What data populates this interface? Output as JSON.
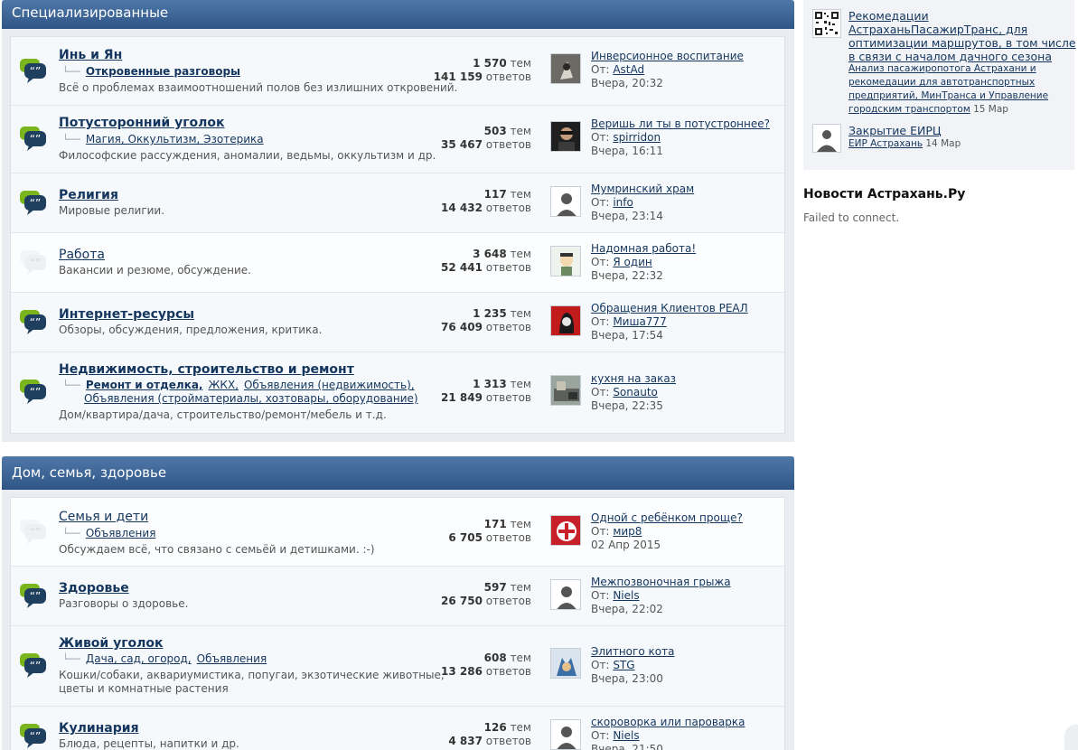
{
  "sections": [
    {
      "title": "Специализированные",
      "forums": [
        {
          "title": "Инь и Ян",
          "read": false,
          "subforums": [
            {
              "label": "Откровенные разговоры",
              "bold": true
            }
          ],
          "description": "Всё о проблемах взаимоотношений полов без излишних откровений.",
          "threads": "1 570",
          "posts": "141 159",
          "last_title": "Инверсионное воспитание",
          "last_user": "AstAd",
          "last_date": "Вчера, 20:32"
        },
        {
          "title": "Потусторонний уголок",
          "read": false,
          "subforums": [
            {
              "label": "Магия, Оккультизм, Эзотерика",
              "bold": false
            }
          ],
          "description": "Философские рассуждения, аномалии, ведьмы, оккультизм и др.",
          "threads": "503",
          "posts": "35 467",
          "last_title": "Веришь ли ты в потустроннее?",
          "last_user": "spirridon",
          "last_date": "Вчера, 16:11"
        },
        {
          "title": "Религия",
          "read": false,
          "subforums": [],
          "description": "Мировые религии.",
          "threads": "117",
          "posts": "14 432",
          "last_title": "Мумринский храм",
          "last_user": "info",
          "last_date": "Вчера, 23:14"
        },
        {
          "title": "Работа",
          "read": true,
          "subforums": [],
          "description": "Вакансии и резюме, обсуждение.",
          "threads": "3 648",
          "posts": "52 441",
          "last_title": "Надомная работа!",
          "last_user": "Я один",
          "last_date": "Вчера, 22:32"
        },
        {
          "title": "Интернет-ресурсы",
          "read": false,
          "subforums": [],
          "description": "Обзоры, обсуждения, предложения, критика.",
          "threads": "1 235",
          "posts": "76 409",
          "last_title": "Обращения Клиентов РЕАЛ",
          "last_user": "Миша777",
          "last_date": "Вчера, 17:54"
        },
        {
          "title": "Недвижимость, строительство и ремонт",
          "read": false,
          "subforums": [
            {
              "label": "Ремонт и отделка,",
              "bold": true
            },
            {
              "label": "ЖКХ,",
              "bold": false
            },
            {
              "label": "Объявления (недвижимость),",
              "bold": false
            }
          ],
          "subforums_line2": "Объявления (стройматериалы, хозтовары, оборудование)",
          "description": "Дом/квартира/дача, строительство/ремонт/мебель и т.д.",
          "threads": "1 313",
          "posts": "21 849",
          "last_title": "кухня на заказ",
          "last_user": "Sonauto",
          "last_date": "Вчера, 22:35"
        }
      ]
    },
    {
      "title": "Дом, семья, здоровье",
      "forums": [
        {
          "title": "Семья и дети",
          "read": true,
          "subforums": [
            {
              "label": "Объявления",
              "bold": false
            }
          ],
          "description": "Обсуждаем всё, что связано с семьёй и детишками. :-)",
          "threads": "171",
          "posts": "6 705",
          "last_title": "Одной с ребёнком проще?",
          "last_user": "мир8",
          "last_date": "02 Апр 2015"
        },
        {
          "title": "Здоровье",
          "read": false,
          "subforums": [],
          "description": "Разговоры о здоровье.",
          "threads": "597",
          "posts": "26 750",
          "last_title": "Межпозвоночная грыжа",
          "last_user": "Niels",
          "last_date": "Вчера, 22:02"
        },
        {
          "title": "Живой уголок",
          "read": false,
          "subforums": [
            {
              "label": "Дача, сад, огород,",
              "bold": false
            },
            {
              "label": "Объявления",
              "bold": false
            }
          ],
          "description": "Кошки/собаки, аквариумистика, попугаи, экзотические животные,",
          "description_line2": "цветы и комнатные растения",
          "threads": "608",
          "posts": "13 286",
          "last_title": "Элитного кота",
          "last_user": "STG",
          "last_date": "Вчера, 23:00"
        },
        {
          "title": "Кулинария",
          "read": false,
          "subforums": [],
          "description": "Блюда, рецепты, напитки и др.",
          "threads": "126",
          "posts": "4 837",
          "last_title": "скороворка или пароварка",
          "last_user": "Niels",
          "last_date": "Вчера, 21:50"
        }
      ]
    }
  ],
  "labels": {
    "threads_word": "тем",
    "posts_word": "ответов",
    "from_prefix": "От:"
  },
  "sidebar": {
    "items": [
      {
        "title": "Рекомедации АстраханьПасажирТранс, для оптимизации маршрутов, в том числе в связи с началом дачного сезона",
        "sub_link": "Анализ пасажиропотога Астрахани и рекомедации для автотранспортных предприятий, МинТранса и Управление городским транспортом",
        "sub_date": "15 Мар"
      },
      {
        "title": "Закрытие ЕИРЦ",
        "sub_link": "ЕИР Астрахань",
        "sub_date": "14 Мар"
      }
    ],
    "news_title": "Новости Астрахань.Ру",
    "news_message": "Failed to connect."
  },
  "colors": {
    "header_top": "#4f78a9",
    "header_bottom": "#2e5585",
    "link": "#14365e"
  }
}
